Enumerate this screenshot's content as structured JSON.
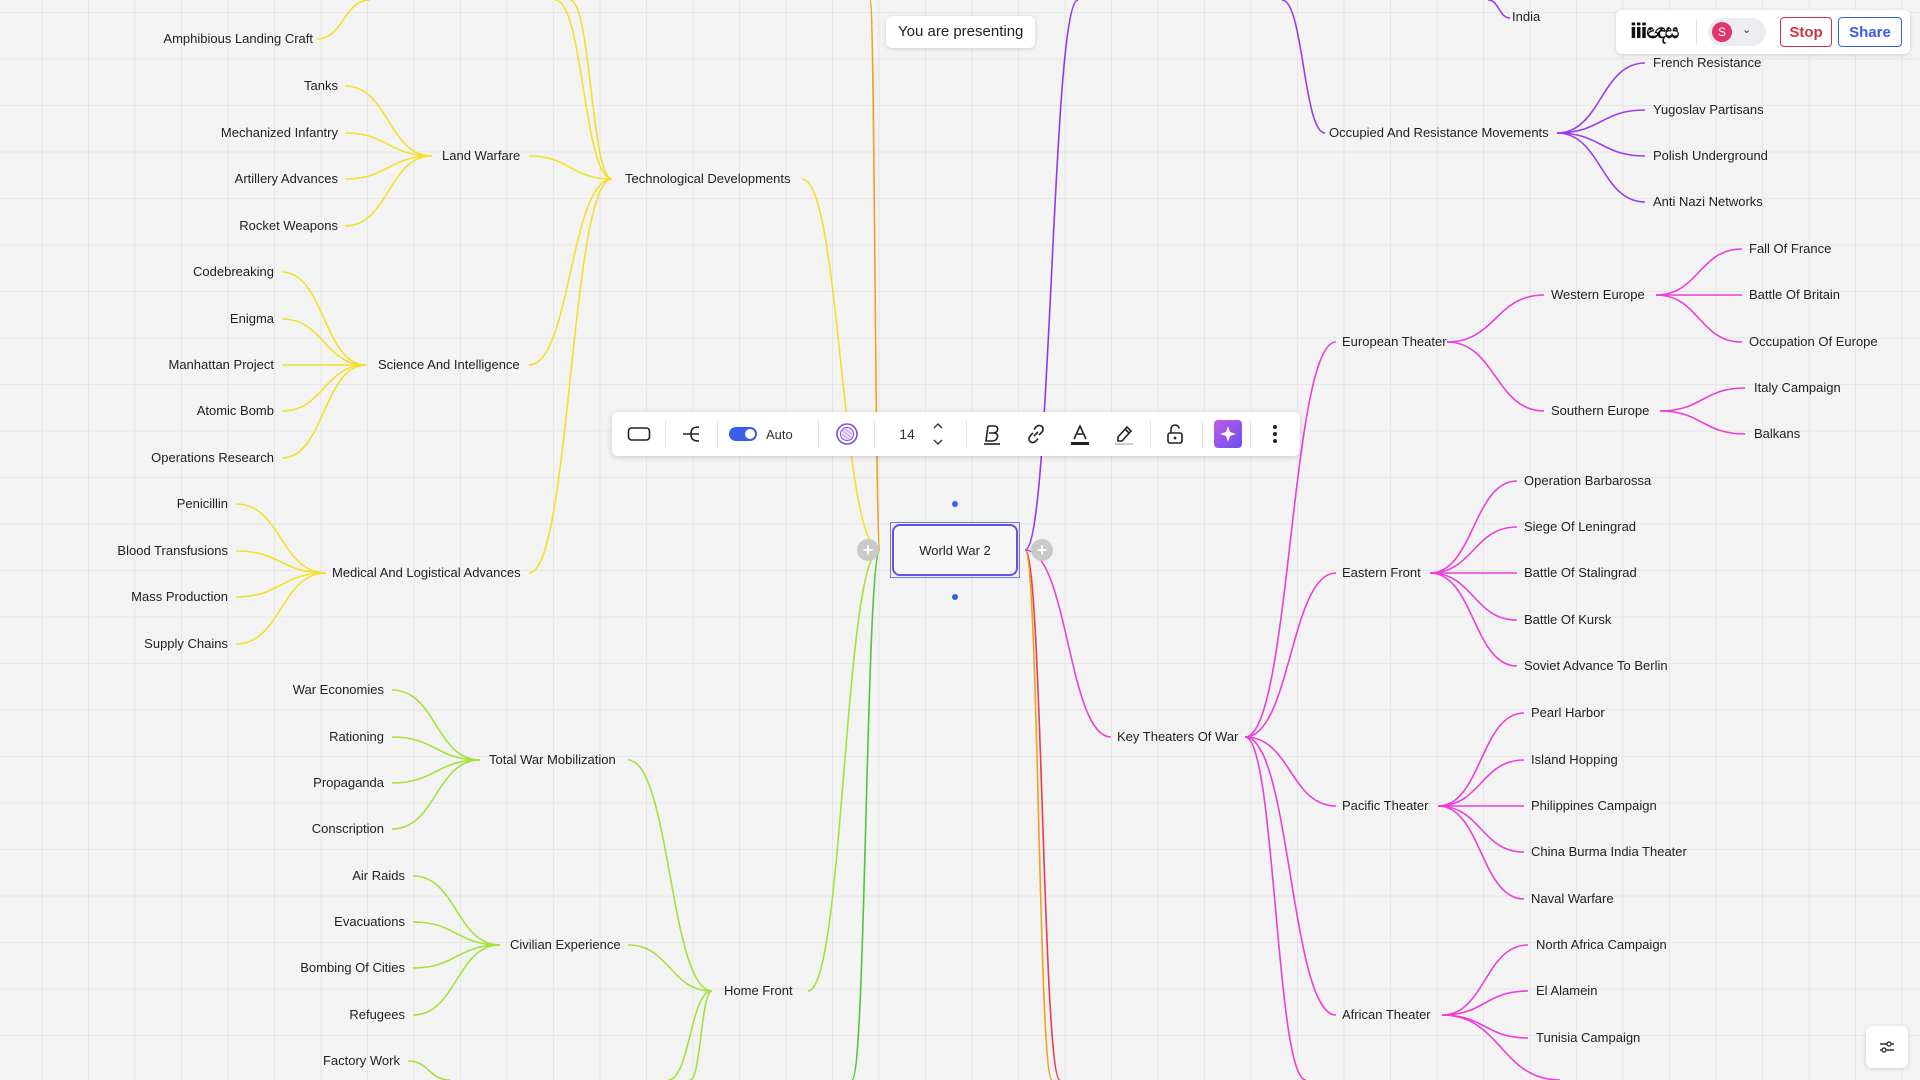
{
  "presenting_text": "You are presenting",
  "header": {
    "logo_text": "ⅲඥස",
    "avatar_initial": "S",
    "stop_label": "Stop",
    "share_label": "Share"
  },
  "toolbar": {
    "toggle_label": "Auto",
    "font_size": "14"
  },
  "mindmap": {
    "root": "World War 2",
    "colors": {
      "tech": "#f2e12a",
      "home": "#a6e03a",
      "theaters": "#ea3fd8",
      "occupied": "#9b3ce8",
      "orange": "#f2a020",
      "purple": "#8a3cf0",
      "green": "#4fc43c",
      "red": "#e83a5a"
    },
    "nodes": {
      "amphibious": "Amphibious Landing Craft",
      "land_warfare": "Land Warfare",
      "tanks": "Tanks",
      "mech_infantry": "Mechanized Infantry",
      "artillery": "Artillery Advances",
      "rocket": "Rocket Weapons",
      "tech_dev": "Technological Developments",
      "science_intel": "Science And Intelligence",
      "codebreaking": "Codebreaking",
      "enigma": "Enigma",
      "manhattan": "Manhattan Project",
      "atomic": "Atomic Bomb",
      "ops_research": "Operations Research",
      "medical": "Medical And Logistical Advances",
      "penicillin": "Penicillin",
      "blood": "Blood Transfusions",
      "mass_prod": "Mass Production",
      "supply": "Supply Chains",
      "total_war": "Total War Mobilization",
      "war_econ": "War Economies",
      "rationing": "Rationing",
      "propaganda": "Propaganda",
      "conscription": "Conscription",
      "civilian": "Civilian Experience",
      "air_raids": "Air Raids",
      "evacuations": "Evacuations",
      "bombing": "Bombing Of Cities",
      "refugees": "Refugees",
      "factory": "Factory Work",
      "home_front": "Home Front",
      "india": "India",
      "occupied": "Occupied And Resistance Movements",
      "french_res": "French Resistance",
      "yugoslav": "Yugoslav Partisans",
      "polish": "Polish Underground",
      "anti_nazi": "Anti Nazi Networks",
      "key_theaters": "Key Theaters Of War",
      "european": "European Theater",
      "western_eu": "Western Europe",
      "fall_france": "Fall Of France",
      "battle_britain": "Battle Of Britain",
      "occupation_eu": "Occupation Of Europe",
      "southern_eu": "Southern Europe",
      "italy": "Italy Campaign",
      "balkans": "Balkans",
      "eastern": "Eastern Front",
      "barbarossa": "Operation Barbarossa",
      "leningrad": "Siege Of Leningrad",
      "stalingrad": "Battle Of Stalingrad",
      "kursk": "Battle Of Kursk",
      "soviet_advance": "Soviet Advance To Berlin",
      "pacific": "Pacific Theater",
      "pearl": "Pearl Harbor",
      "island": "Island Hopping",
      "philippines": "Philippines Campaign",
      "cbi": "China Burma India Theater",
      "naval": "Naval Warfare",
      "african": "African Theater",
      "north_africa": "North Africa Campaign",
      "el_alamein": "El Alamein",
      "tunisia": "Tunisia Campaign"
    }
  }
}
